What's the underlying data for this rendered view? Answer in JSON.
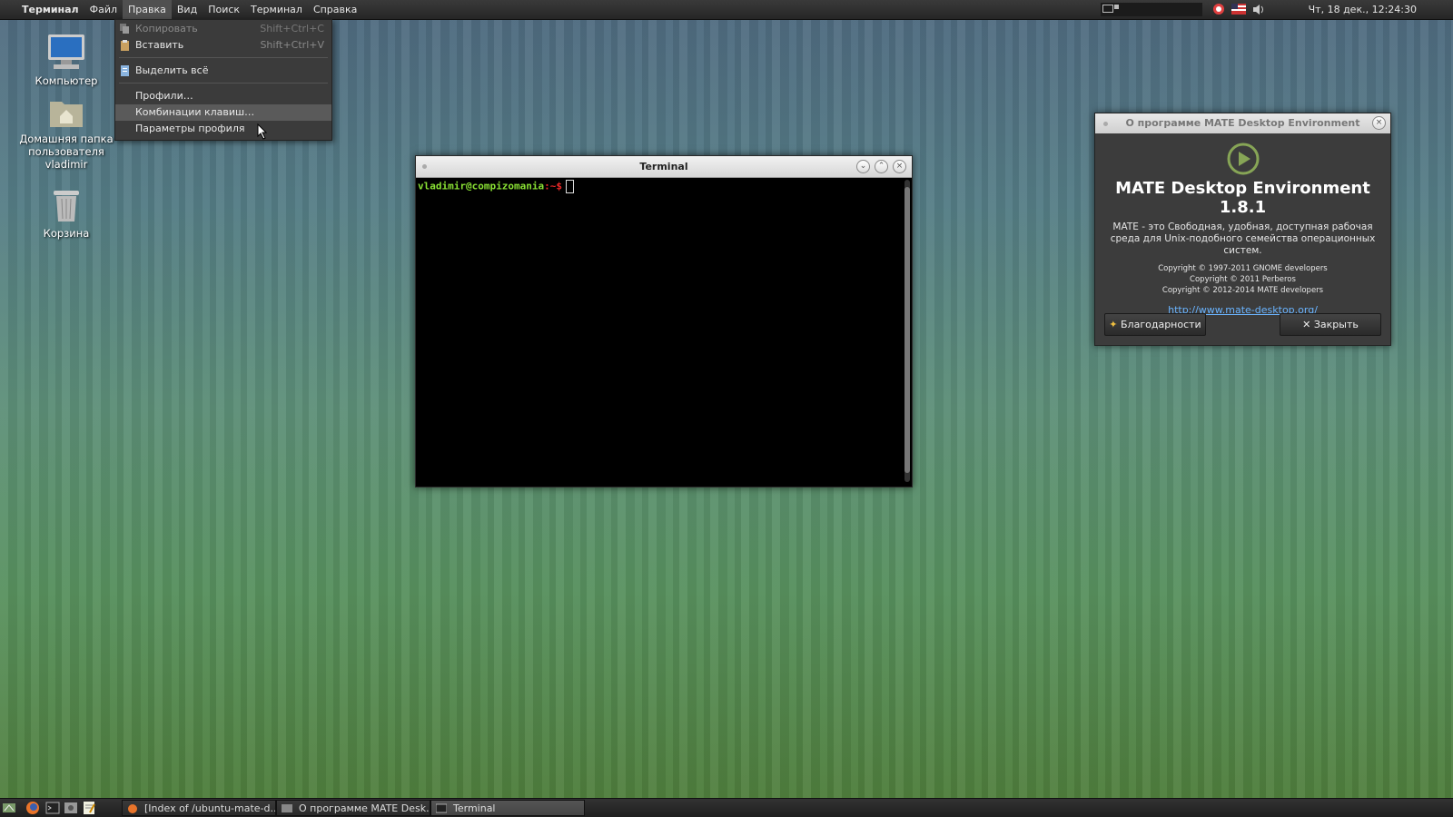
{
  "top_panel": {
    "menu": [
      "Терминал",
      "Файл",
      "Правка",
      "Вид",
      "Поиск",
      "Терминал",
      "Справка"
    ],
    "clock": "Чт, 18 дек., 12:24:30"
  },
  "edit_menu": {
    "copy": {
      "label": "Копировать",
      "accel": "Shift+Ctrl+C"
    },
    "paste": {
      "label": "Вставить",
      "accel": "Shift+Ctrl+V"
    },
    "select_all": "Выделить всё",
    "profiles": "Профили…",
    "shortcuts": "Комбинации клавиш…",
    "profile_prefs": "Параметры профиля"
  },
  "desktop": {
    "computer": "Компьютер",
    "home": [
      "Домашняя папка",
      "пользователя",
      "vladimir"
    ],
    "trash": "Корзина"
  },
  "terminal": {
    "title": "Terminal",
    "prompt_user": "vladimir@compizomania",
    "prompt_path": ":~$"
  },
  "about": {
    "title": "О программе MATE Desktop Environment",
    "name": "MATE Desktop Environment 1.8.1",
    "description": "MATE - это Свободная, удобная, доступная рабочая среда для Unix-подобного семейства операционных систем.",
    "copyright": [
      "Copyright © 1997-2011 GNOME developers",
      "Copyright © 2011 Perberos",
      "Copyright © 2012-2014 MATE developers"
    ],
    "url": "http://www.mate-desktop.org/",
    "credits_button": "Благодарности",
    "close_button": "Закрыть"
  },
  "taskbar": {
    "tasks": [
      "[Index of /ubuntu-mate-d...",
      "О программе MATE Desk...",
      "Terminal"
    ]
  },
  "colors": {
    "prompt_user": "#8ae234",
    "prompt_path": "#ef2929",
    "link": "#6ab4ff"
  }
}
